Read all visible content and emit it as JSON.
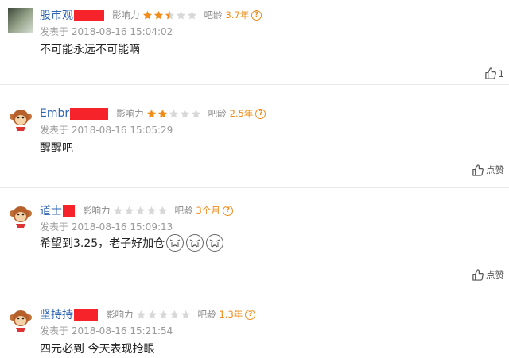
{
  "labels": {
    "influence": "影响力",
    "bar_age": "吧龄",
    "posted_prefix": "发表于",
    "like_default": "点赞"
  },
  "colors": {
    "username": "#2d64b3",
    "star_on": "#f08c1a",
    "star_off": "#d8d8d8",
    "redaction": "#f6232b",
    "age": "#f08c1a"
  },
  "comments": [
    {
      "username": "股市观",
      "avatar": "photo-avatar",
      "stars": 2.5,
      "bar_age": "3.7年",
      "date": "发表于 2018-08-16 15:04:02",
      "text": "不可能永远不可能嘀",
      "likes": "1"
    },
    {
      "username": "Embr",
      "avatar": "monkey-avatar",
      "stars": 2,
      "bar_age": "2.5年",
      "date": "发表于 2018-08-16 15:05:29",
      "text": "醒醒吧",
      "likes": "点赞"
    },
    {
      "username": "道士",
      "avatar": "monkey-avatar",
      "stars": 0,
      "bar_age": "3个月",
      "date": "发表于 2018-08-16 15:09:13",
      "text": "希望到3.25，老子好加仓",
      "emoji": [
        "crying-face-icon",
        "crying-face-icon",
        "crying-face-icon"
      ],
      "likes": "点赞"
    },
    {
      "username": "坚持持",
      "avatar": "monkey-avatar",
      "stars": 0,
      "bar_age": "1.3年",
      "date": "发表于 2018-08-16 15:21:54",
      "text": "四元必到 今天表现抢眼",
      "likes": ""
    }
  ]
}
